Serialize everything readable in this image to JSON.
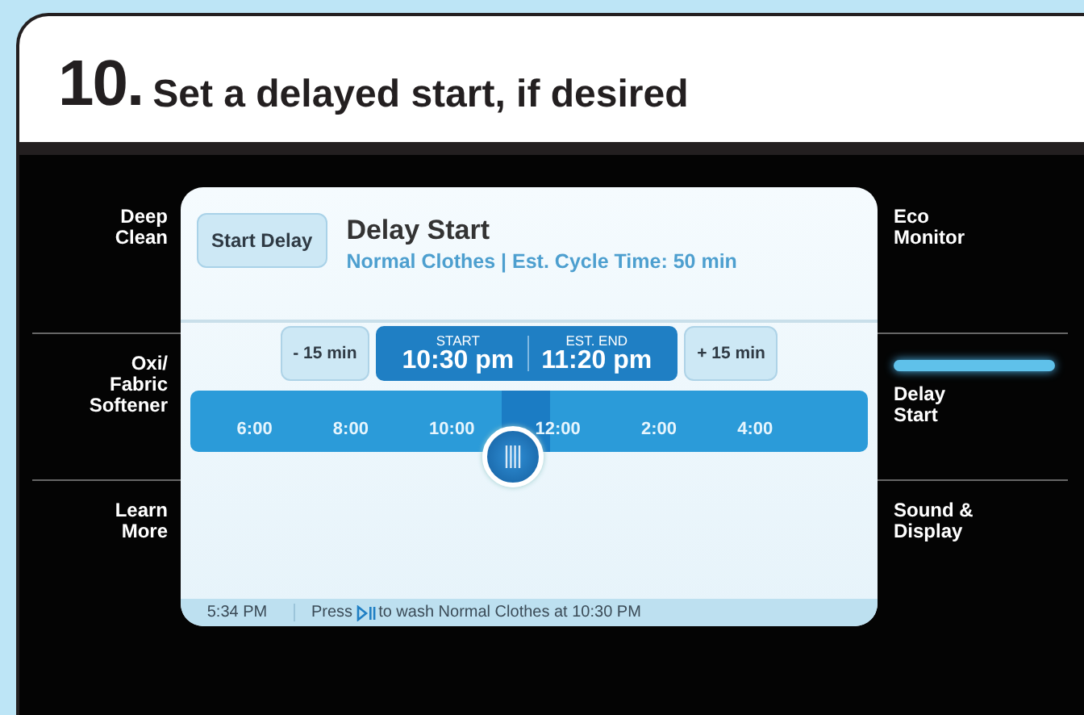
{
  "step": {
    "number": "10.",
    "title": "Set a delayed start, if desired"
  },
  "left_menu": [
    {
      "label": "Deep\nClean",
      "selected": false
    },
    {
      "label": "Oxi/\nFabric\nSoftener",
      "selected": false
    },
    {
      "label": "Learn\nMore",
      "selected": false
    }
  ],
  "right_menu": [
    {
      "label": "Eco\nMonitor",
      "selected": false
    },
    {
      "label": "Delay\nStart",
      "selected": true
    },
    {
      "label": "Sound &\nDisplay",
      "selected": false
    }
  ],
  "screen": {
    "start_delay_button": "Start Delay",
    "title": "Delay Start",
    "subtitle": "Normal Clothes | Est. Cycle Time: 50 min",
    "minus_button": "- 15 min",
    "plus_button": "+ 15 min",
    "start": {
      "label": "START",
      "time": "10:30 pm"
    },
    "end": {
      "label": "EST. END",
      "time": "11:20 pm"
    },
    "timeline": {
      "labels": [
        "6:00",
        "8:00",
        "10:00",
        "12:00",
        "2:00",
        "4:00"
      ],
      "level": 0.47
    },
    "status_bar": {
      "clock": "5:34 PM",
      "message_before": "Press",
      "message_after": "to wash Normal Clothes at 10:30 PM"
    }
  }
}
